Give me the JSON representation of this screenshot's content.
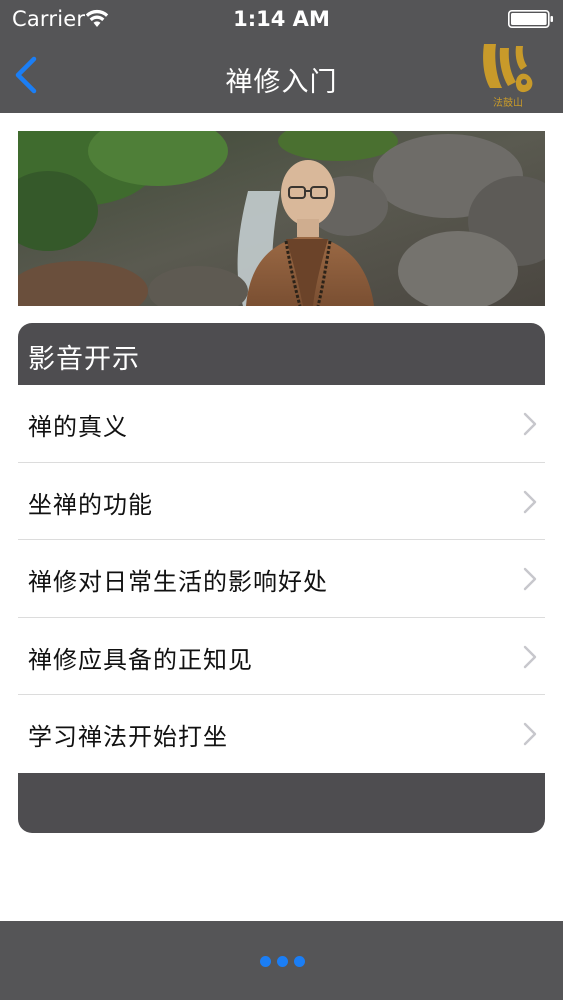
{
  "status_bar": {
    "carrier": "Carrier",
    "time": "1:14 AM"
  },
  "nav": {
    "title": "禅修入门",
    "logo_caption": "法鼓山"
  },
  "section": {
    "title": "影音开示",
    "items": [
      {
        "label": "禅的真义"
      },
      {
        "label": "坐禅的功能"
      },
      {
        "label": "禅修对日常生活的影响好处"
      },
      {
        "label": "禅修应具备的正知见"
      },
      {
        "label": "学习禅法开始打坐"
      }
    ]
  },
  "colors": {
    "bar_background": "#555557",
    "section_background": "#4e4d50",
    "accent_blue": "#1b7ef5",
    "logo_gold": "#c89a2a"
  },
  "icons": {
    "back": "chevron-left-icon",
    "row_disclosure": "chevron-right-icon",
    "wifi": "wifi-icon",
    "battery": "battery-icon",
    "page_indicator": "more-dots-icon"
  }
}
